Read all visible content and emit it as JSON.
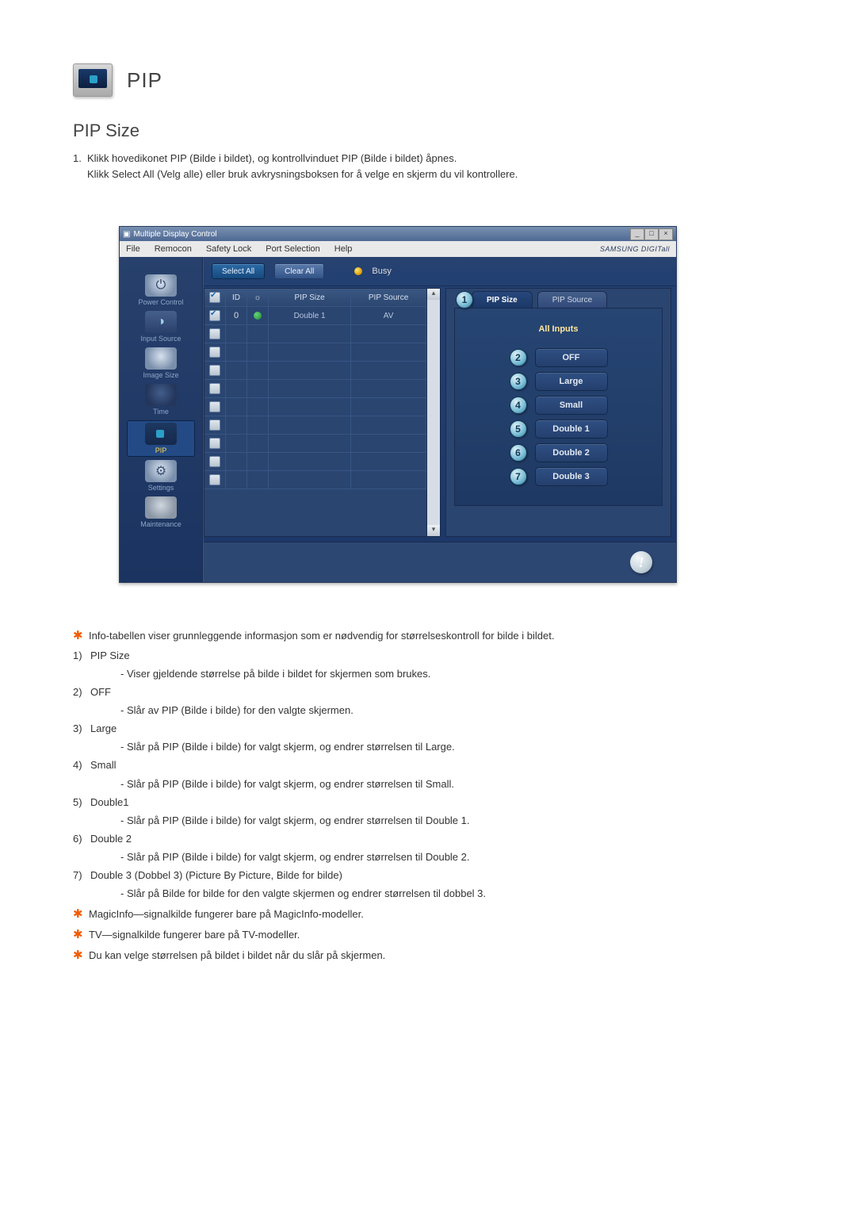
{
  "header": {
    "title": "PIP"
  },
  "section_title": "PIP Size",
  "intro": {
    "line1": "Klikk hovedikonet PIP (Bilde i bildet), og kontrollvinduet PIP (Bilde i bildet) åpnes.",
    "line2": "Klikk Select All (Velg alle) eller bruk avkrysningsboksen for å velge en skjerm du vil kontrollere."
  },
  "app": {
    "window_title": "Multiple Display Control",
    "menus": [
      "File",
      "Remocon",
      "Safety Lock",
      "Port Selection",
      "Help"
    ],
    "brand": "SAMSUNG DIGITall",
    "toolbar": {
      "select_all": "Select All",
      "clear_all": "Clear All",
      "busy": "Busy"
    },
    "sidebar": [
      {
        "label": "Power Control",
        "type": "power"
      },
      {
        "label": "Input Source",
        "type": "input"
      },
      {
        "label": "Image Size",
        "type": "image"
      },
      {
        "label": "Time",
        "type": "time"
      },
      {
        "label": "PIP",
        "type": "pip",
        "active": true
      },
      {
        "label": "Settings",
        "type": "settings"
      },
      {
        "label": "Maintenance",
        "type": "maint"
      }
    ],
    "grid": {
      "headers": {
        "id": "ID",
        "pip_size": "PIP Size",
        "pip_source": "PIP Source"
      },
      "rows": [
        {
          "checked": true,
          "id": "0",
          "signal": true,
          "size": "Double 1",
          "source": "AV"
        }
      ],
      "empty_rows": 9
    },
    "panel": {
      "tabs": {
        "size": "PIP Size",
        "source": "PIP Source"
      },
      "tab_badge": "1",
      "header": "All Inputs",
      "options": [
        {
          "badge": "2",
          "label": "OFF"
        },
        {
          "badge": "3",
          "label": "Large"
        },
        {
          "badge": "4",
          "label": "Small"
        },
        {
          "badge": "5",
          "label": "Double 1"
        },
        {
          "badge": "6",
          "label": "Double 2"
        },
        {
          "badge": "7",
          "label": "Double 3"
        }
      ]
    }
  },
  "notes": {
    "star_info": "Info-tabellen viser grunnleggende informasjon som er nødvendig for størrelseskontroll for bilde i bildet.",
    "items": [
      {
        "n": "1)",
        "title": "PIP Size",
        "sub": "- Viser gjeldende størrelse på bilde i bildet for skjermen som brukes."
      },
      {
        "n": "2)",
        "title": "OFF",
        "sub": "- Slår av PIP (Bilde i bilde) for den valgte skjermen."
      },
      {
        "n": "3)",
        "title": "Large",
        "sub": "- Slår på PIP (Bilde i bilde) for valgt skjerm, og endrer størrelsen til Large."
      },
      {
        "n": "4)",
        "title": "Small",
        "sub": "- Slår på PIP (Bilde i bilde) for valgt skjerm, og endrer størrelsen til Small."
      },
      {
        "n": "5)",
        "title": "Double1",
        "sub": "- Slår på PIP (Bilde i bilde) for valgt skjerm, og endrer størrelsen til Double 1."
      },
      {
        "n": "6)",
        "title": "Double 2",
        "sub": "- Slår på PIP (Bilde i bilde) for valgt skjerm, og endrer størrelsen til Double 2."
      },
      {
        "n": "7)",
        "title": "Double 3 (Dobbel 3) (Picture By Picture, Bilde for bilde)",
        "sub": "- Slår på Bilde for bilde for den valgte skjermen og endrer størrelsen til dobbel 3."
      }
    ],
    "star2": "MagicInfo—signalkilde fungerer bare på MagicInfo-modeller.",
    "star3": "TV—signalkilde fungerer bare på TV-modeller.",
    "star4": "Du kan velge størrelsen på bildet i bildet når du slår på skjermen."
  }
}
